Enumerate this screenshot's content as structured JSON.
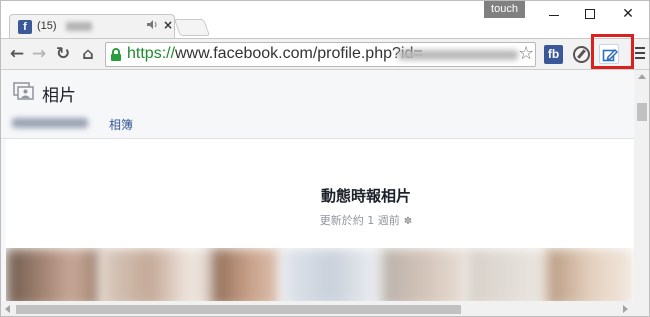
{
  "browser": {
    "tab": {
      "favicon_letter": "f",
      "title_count": "(15)",
      "audio_icon": "speaker-icon",
      "close_glyph": "×"
    },
    "touch_label": "touch",
    "window_controls": {
      "close_glyph": "✕"
    },
    "toolbar": {
      "back_glyph": "←",
      "forward_glyph": "→",
      "reload_glyph": "↻",
      "home_glyph": "⌂",
      "url_scheme": "https://",
      "url_rest": "www.facebook.com/profile.php?id=",
      "star_glyph": "☆",
      "extensions": [
        {
          "name": "fb",
          "label": "fb",
          "color": "#3b5998"
        },
        {
          "name": "compass-icon"
        },
        {
          "name": "edit-page-icon",
          "highlighted": true,
          "highlight_color": "#d9211f"
        }
      ]
    }
  },
  "page": {
    "header": {
      "title": "相片",
      "subtabs": [
        {
          "label": "相簿",
          "active": false
        }
      ]
    },
    "album": {
      "title": "動態時報相片",
      "updated": "更新於約 1 週前",
      "gear_glyph": "✽"
    }
  },
  "colors": {
    "facebook_blue": "#3b5998",
    "link_blue": "#365899",
    "secure_green": "#1e8a2e",
    "highlight_red": "#d9211f"
  }
}
